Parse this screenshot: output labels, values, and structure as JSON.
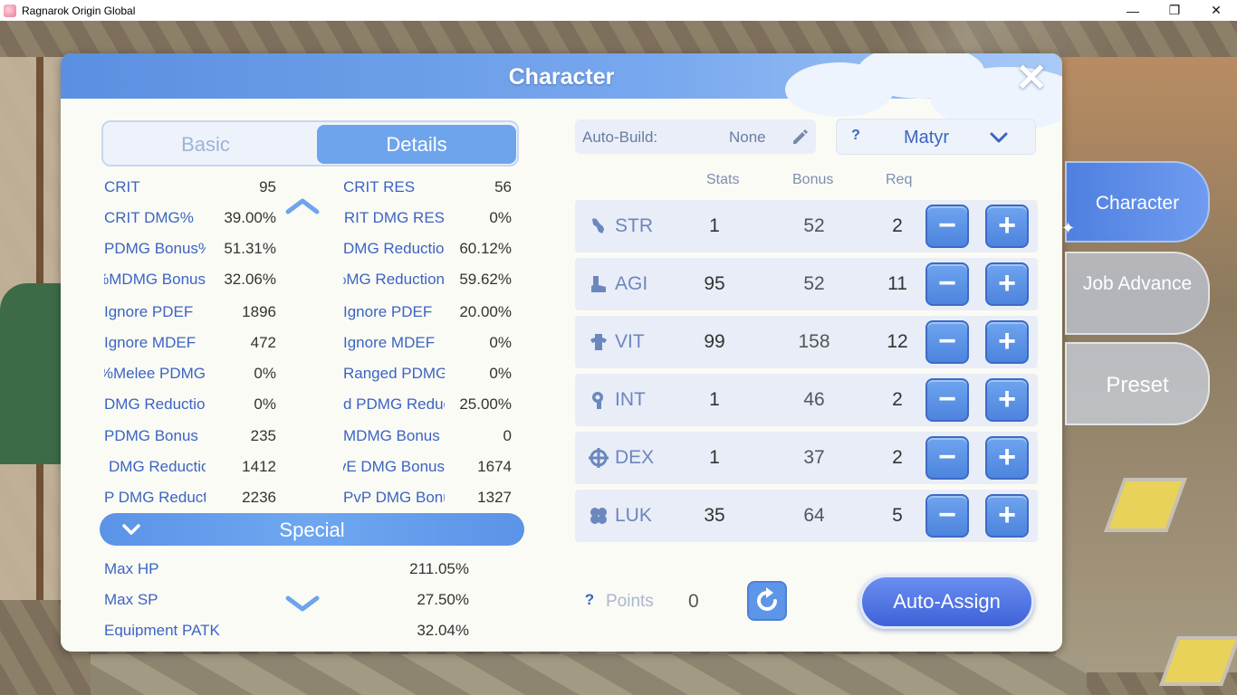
{
  "window": {
    "title": "Ragnarok Origin Global",
    "minimize": "—",
    "maximize": "❐",
    "close": "✕"
  },
  "panel": {
    "title": "Character",
    "close_label": "✕"
  },
  "tabs": [
    {
      "label": "Basic",
      "active": false
    },
    {
      "label": "Details",
      "active": true
    }
  ],
  "stats_left": [
    {
      "name": "CRIT",
      "value": "95"
    },
    {
      "name": "CRIT DMG%",
      "value": "39.00%"
    },
    {
      "name": "PDMG Bonus%",
      "value": "51.31%"
    },
    {
      "name": "MDMG Bonus%",
      "value": "32.06%"
    },
    {
      "name": "Ignore PDEF",
      "value": "1896"
    },
    {
      "name": "Ignore MDEF",
      "value": "472"
    },
    {
      "name": "Melee PDMG%",
      "value": "0%"
    },
    {
      "name": "DMG Reduction",
      "value": "0%"
    },
    {
      "name": "PDMG Bonus",
      "value": "235"
    },
    {
      "name": "DMG Reduction",
      "value": "1412"
    },
    {
      "name": "P DMG Reduction",
      "value": "2236"
    }
  ],
  "stats_right": [
    {
      "name": "CRIT RES",
      "value": "56"
    },
    {
      "name": "CRIT DMG RES",
      "value": "0%"
    },
    {
      "name": "DMG Reduction",
      "value": "60.12%"
    },
    {
      "name": "MG Reduction%",
      "value": "59.62%"
    },
    {
      "name": "Ignore PDEF",
      "value": "20.00%"
    },
    {
      "name": "Ignore MDEF",
      "value": "0%"
    },
    {
      "name": "Ranged PDMG%",
      "value": "0%"
    },
    {
      "name": "d PDMG Reduction",
      "value": "25.00%"
    },
    {
      "name": "MDMG Bonus",
      "value": "0"
    },
    {
      "name": "PvE DMG Bonus",
      "value": "1674"
    },
    {
      "name": "PvP DMG Bonus",
      "value": "1327"
    }
  ],
  "special": {
    "label": "Special",
    "items": [
      {
        "name": "Max HP",
        "value": "211.05%"
      },
      {
        "name": "Max SP",
        "value": "27.50%"
      },
      {
        "name": "Equipment PATK",
        "value": "32.04%"
      }
    ]
  },
  "autobuild": {
    "label": "Auto-Build:",
    "value": "None"
  },
  "job_select": {
    "help": "?",
    "value": "Matyr"
  },
  "columns": {
    "stats": "Stats",
    "bonus": "Bonus",
    "req": "Req"
  },
  "attributes": [
    {
      "name": "STR",
      "icon": "str-icon",
      "stats": "1",
      "bonus": "52",
      "req": "2"
    },
    {
      "name": "AGI",
      "icon": "agi-icon",
      "stats": "95",
      "bonus": "52",
      "req": "11"
    },
    {
      "name": "VIT",
      "icon": "vit-icon",
      "stats": "99",
      "bonus": "158",
      "req": "12"
    },
    {
      "name": "INT",
      "icon": "int-icon",
      "stats": "1",
      "bonus": "46",
      "req": "2"
    },
    {
      "name": "DEX",
      "icon": "dex-icon",
      "stats": "1",
      "bonus": "37",
      "req": "2"
    },
    {
      "name": "LUK",
      "icon": "luk-icon",
      "stats": "35",
      "bonus": "64",
      "req": "5"
    }
  ],
  "buttons": {
    "minus": "−",
    "plus": "+"
  },
  "points": {
    "help": "?",
    "label": "Points",
    "value": "0"
  },
  "auto_assign": "Auto-Assign",
  "side_tabs": [
    {
      "label": "Character",
      "active": true
    },
    {
      "label": "Job Advance",
      "active": false
    },
    {
      "label": "Preset",
      "active": false
    }
  ],
  "colors": {
    "accent": "#5b93e8",
    "text_blue": "#3b64c2",
    "panel_bg": "#fbfbf6"
  }
}
